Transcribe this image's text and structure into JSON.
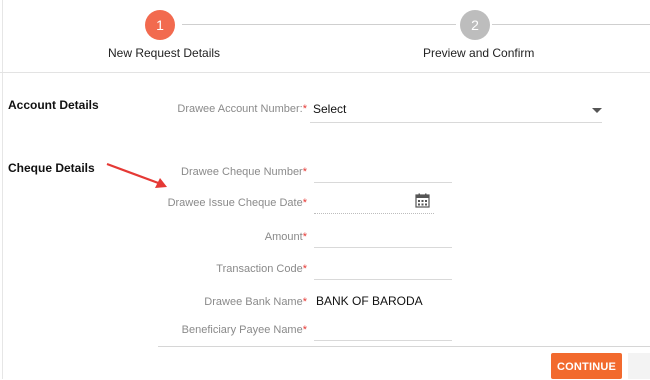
{
  "stepper": {
    "steps": [
      {
        "number": "1",
        "label": "New Request Details",
        "color": "#f26a4f"
      },
      {
        "number": "2",
        "label": "Preview and Confirm",
        "color": "#bdbdbd"
      }
    ]
  },
  "account": {
    "section_title": "Account Details",
    "drawee_account_label": "Drawee Account Number:",
    "drawee_account_value": "Select"
  },
  "cheque": {
    "section_title": "Cheque Details",
    "fields": {
      "cheque_number_label": "Drawee Cheque Number",
      "issue_date_label": "Drawee Issue Cheque Date",
      "amount_label": "Amount",
      "transaction_code_label": "Transaction Code",
      "bank_name_label": "Drawee Bank Name",
      "bank_name_value": "BANK OF BARODA",
      "payee_name_label": "Beneficiary Payee Name"
    },
    "required_mark": "*"
  },
  "actions": {
    "continue_label": "CONTINUE"
  },
  "colors": {
    "accent": "#f26a2e",
    "required": "#e53935",
    "arrow": "#e53935"
  }
}
